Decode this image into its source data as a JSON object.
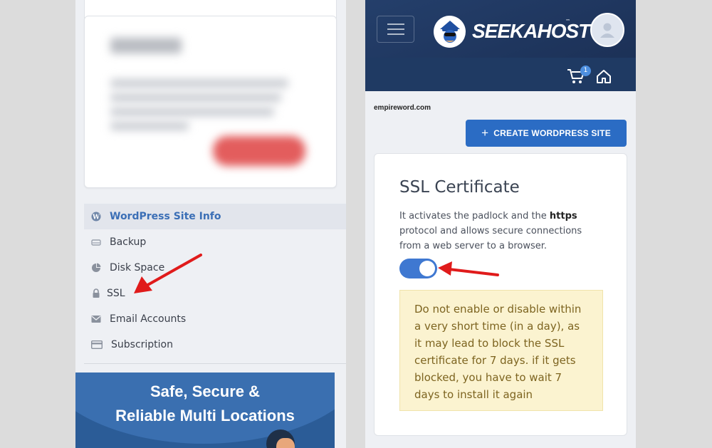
{
  "left": {
    "menu": [
      {
        "label": "WordPress Site Info",
        "icon": "wordpress-icon",
        "active": true
      },
      {
        "label": "Backup",
        "icon": "hdd-icon"
      },
      {
        "label": "Disk Space",
        "icon": "pie-chart-icon"
      },
      {
        "label": "SSL",
        "icon": "lock-icon"
      },
      {
        "label": "Email Accounts",
        "icon": "envelope-icon"
      },
      {
        "label": "Subscription",
        "icon": "credit-card-icon"
      }
    ],
    "banner": {
      "line1": "Safe, Secure &",
      "line2": "Reliable Multi Locations"
    }
  },
  "right": {
    "header": {
      "logo_text": "SEEKAHOST",
      "logo_tm": "™",
      "cart_count": "1"
    },
    "domain": "empireword.com",
    "create_button": {
      "plus": "+",
      "label": "CREATE WORDPRESS SITE"
    },
    "ssl": {
      "title": "SSL Certificate",
      "desc_part1": "It activates the padlock and the ",
      "desc_bold": "https",
      "desc_part2": " protocol and allows secure connections from a web server to a browser.",
      "enabled": true,
      "warning": "Do not enable or disable within a very short time (in a day), as it may lead to block the SSL certificate for 7 days. if it gets blocked, you have to wait 7 days to install it again"
    }
  },
  "colors": {
    "accent": "#2b6cc4",
    "header": "#1f3a63",
    "toggle_on": "#3f78d1",
    "warning_bg": "#fbf3d0",
    "annotation_arrow": "#e01b1b"
  }
}
